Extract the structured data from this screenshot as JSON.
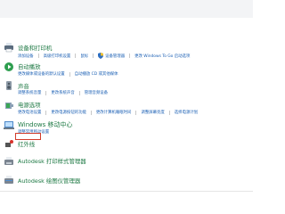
{
  "top_strip": {
    "text": ""
  },
  "sections": [
    {
      "id": "devices",
      "title": "设备和打印机",
      "icon": "printer-icon",
      "links": [
        {
          "label": "添加设备"
        },
        {
          "label": "高级打印机设置"
        },
        {
          "label": "鼠标"
        },
        {
          "label": "设备管理器",
          "shield": true
        },
        {
          "label": "更改 Windows To Go 启动选项"
        }
      ]
    },
    {
      "id": "autoplay",
      "title": "自动播放",
      "icon": "autoplay-icon",
      "links": [
        {
          "label": "更改媒体或设备的默认设置"
        },
        {
          "label": "自动播放 CD 或其他媒体"
        }
      ]
    },
    {
      "id": "sound",
      "title": "声音",
      "icon": "speaker-icon",
      "links": [
        {
          "label": "调整系统音量"
        },
        {
          "label": "更改系统声音"
        },
        {
          "label": "管理音频设备"
        }
      ]
    },
    {
      "id": "power",
      "title": "电源选项",
      "icon": "power-options-icon",
      "links": [
        {
          "label": "更改电池设置"
        },
        {
          "label": "更改电源按钮的功能"
        },
        {
          "label": "更改计算机睡眠时间"
        },
        {
          "label": "调整屏幕亮度"
        },
        {
          "label": "选择电源计划"
        }
      ]
    },
    {
      "id": "mobility",
      "title": "Windows 移动中心",
      "icon": "mobility-center-icon",
      "links": [
        {
          "label": "调整常用移动设置"
        }
      ]
    },
    {
      "id": "infrared",
      "title": "红外线",
      "icon": "infrared-icon",
      "links": []
    },
    {
      "id": "autodesk-print",
      "title": "Autodesk 打印样式管理器",
      "icon": "autodesk-print-style-icon",
      "links": []
    },
    {
      "id": "autodesk-plotter",
      "title": "Autodesk 绘图仪管理器",
      "icon": "autodesk-plotter-icon",
      "links": []
    }
  ],
  "highlight": {
    "target": "更改电池设置",
    "color": "#d23b2a"
  },
  "colors": {
    "heading": "#1f7a45",
    "link": "#1a5fb4"
  }
}
